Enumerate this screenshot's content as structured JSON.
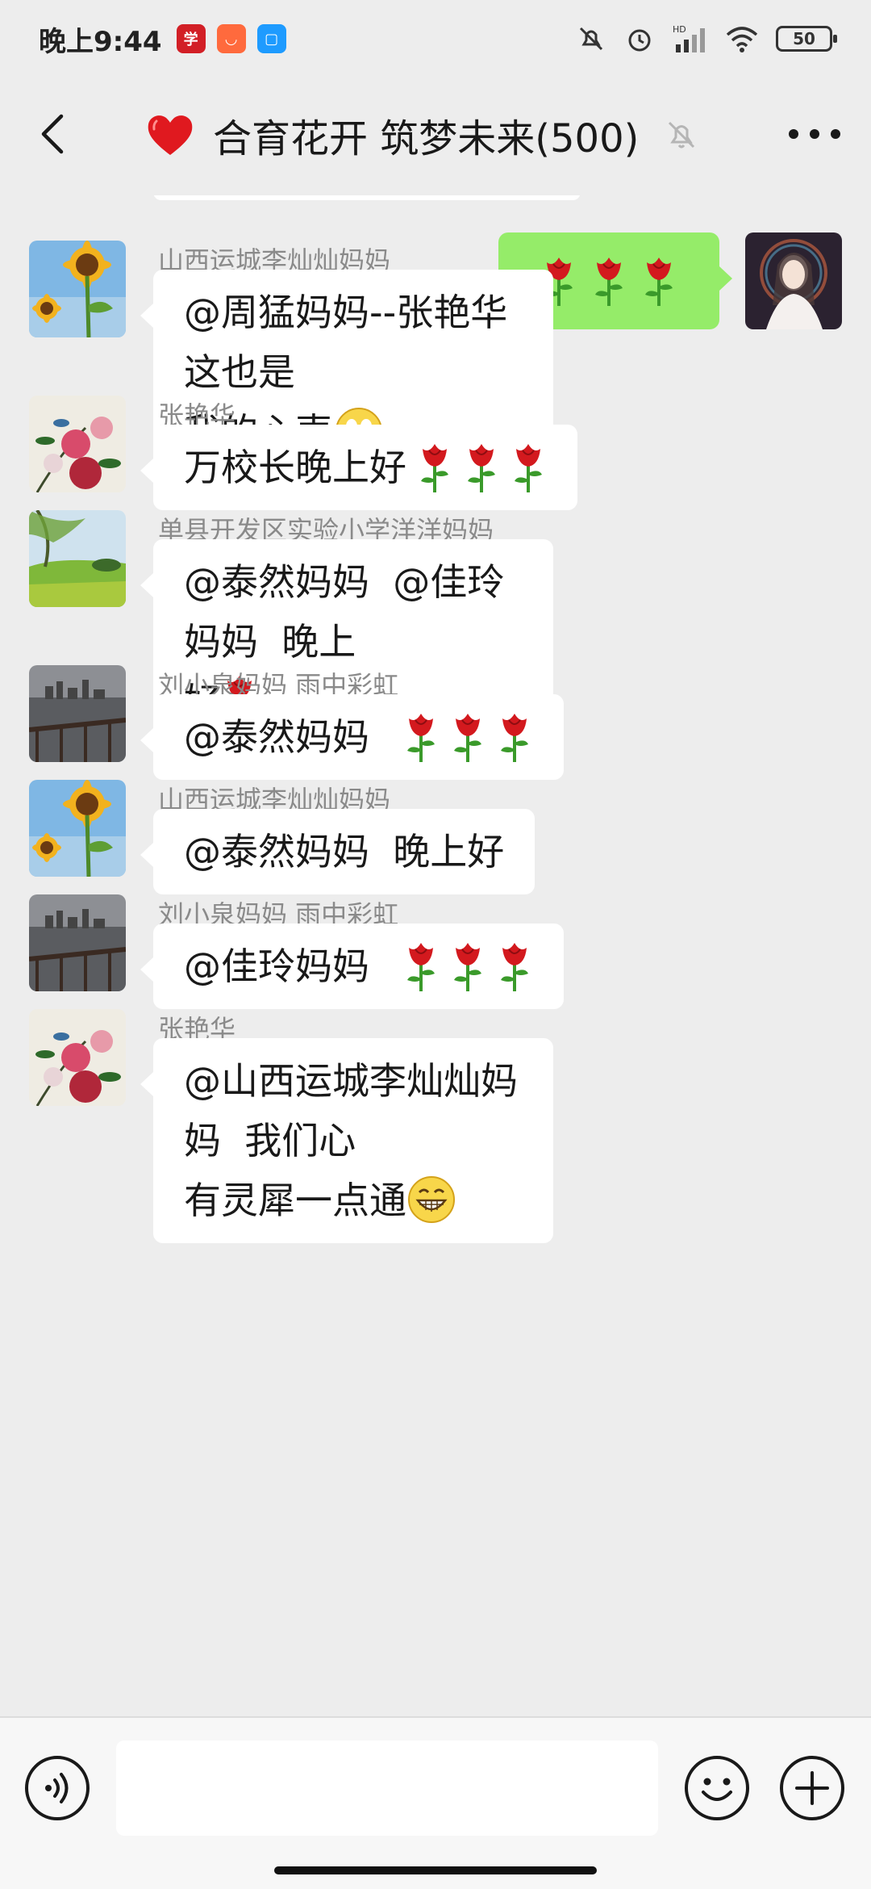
{
  "status_bar": {
    "time": "晚上9:44",
    "battery": "50",
    "signal_label": "HD"
  },
  "header": {
    "title": "合育花开 筑梦未来(500)"
  },
  "messages": [
    {
      "sender": "山西运城李灿灿妈妈",
      "text": "@周猛妈妈--张艳华  这也是\n我的心声"
    },
    {
      "sender": "张艳华",
      "text": "万校长晚上好"
    },
    {
      "sender": "单县开发区实验小学洋洋妈妈",
      "text": "@泰然妈妈  @佳玲妈妈  晚上\n好"
    },
    {
      "sender": "刘小泉妈妈  雨中彩虹",
      "text": "@泰然妈妈  "
    },
    {
      "sender": "山西运城李灿灿妈妈",
      "text": "@泰然妈妈  晚上好"
    },
    {
      "sender": "刘小泉妈妈  雨中彩虹",
      "text": "@佳玲妈妈  "
    },
    {
      "sender": "张艳华",
      "text": "@山西运城李灿灿妈妈  我们心\n有灵犀一点通"
    }
  ],
  "input": {
    "placeholder": ""
  },
  "colors": {
    "background": "#ededed",
    "my_bubble": "#95ec69",
    "their_bubble": "#ffffff"
  }
}
